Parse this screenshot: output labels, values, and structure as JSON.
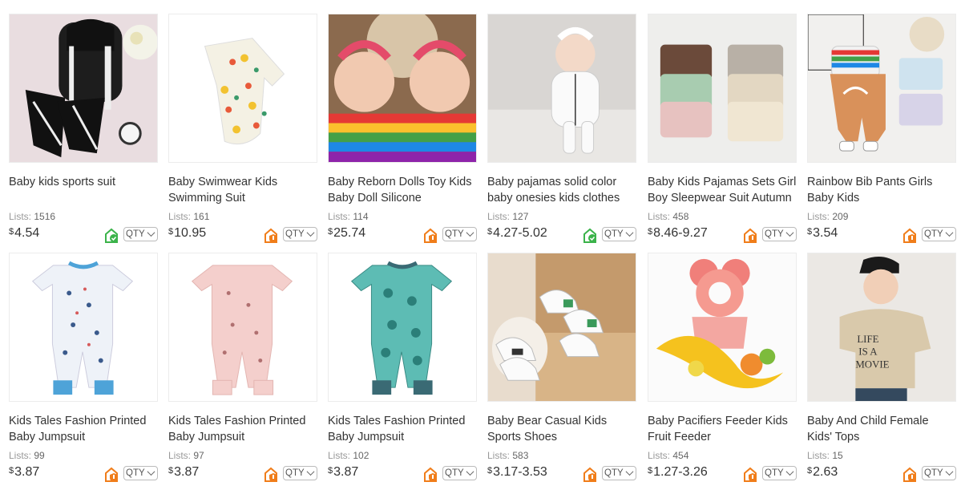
{
  "products": [
    {
      "title": "Baby kids sports suit",
      "lists_label": "Lists:",
      "lists": "1516",
      "currency": "$",
      "price": "4.54",
      "badge": "green-shield-icon",
      "qty_label": "QTY"
    },
    {
      "title": "Baby Swimwear Kids Swimming Suit",
      "lists_label": "Lists:",
      "lists": "161",
      "currency": "$",
      "price": "10.95",
      "badge": "orange-shield-icon",
      "qty_label": "QTY"
    },
    {
      "title": "Baby Reborn Dolls Toy Kids Baby Doll Silicone",
      "lists_label": "Lists:",
      "lists": "114",
      "currency": "$",
      "price": "25.74",
      "badge": "orange-shield-icon",
      "qty_label": "QTY"
    },
    {
      "title": "Baby pajamas solid color baby onesies kids clothes",
      "lists_label": "Lists:",
      "lists": "127",
      "currency": "$",
      "price": "4.27-5.02",
      "badge": "green-shield-icon",
      "qty_label": "QTY"
    },
    {
      "title": "Baby Kids Pajamas Sets Girl Boy Sleepwear Suit Autumn",
      "lists_label": "Lists:",
      "lists": "458",
      "currency": "$",
      "price": "8.46-9.27",
      "badge": "orange-shield-icon",
      "qty_label": "QTY"
    },
    {
      "title": "Rainbow Bib Pants Girls Baby Kids",
      "lists_label": "Lists:",
      "lists": "209",
      "currency": "$",
      "price": "3.54",
      "badge": "orange-shield-icon",
      "qty_label": "QTY"
    },
    {
      "title": "Kids Tales Fashion Printed Baby Jumpsuit",
      "lists_label": "Lists:",
      "lists": "99",
      "currency": "$",
      "price": "3.87",
      "badge": "orange-shield-icon",
      "qty_label": "QTY"
    },
    {
      "title": "Kids Tales Fashion Printed Baby Jumpsuit",
      "lists_label": "Lists:",
      "lists": "97",
      "currency": "$",
      "price": "3.87",
      "badge": "orange-shield-icon",
      "qty_label": "QTY"
    },
    {
      "title": "Kids Tales Fashion Printed Baby Jumpsuit",
      "lists_label": "Lists:",
      "lists": "102",
      "currency": "$",
      "price": "3.87",
      "badge": "orange-shield-icon",
      "qty_label": "QTY"
    },
    {
      "title": "Baby Bear Casual Kids Sports Shoes",
      "lists_label": "Lists:",
      "lists": "583",
      "currency": "$",
      "price": "3.17-3.53",
      "badge": "orange-shield-icon",
      "qty_label": "QTY"
    },
    {
      "title": "Baby Pacifiers Feeder Kids Fruit Feeder",
      "lists_label": "Lists:",
      "lists": "454",
      "currency": "$",
      "price": "1.27-3.26",
      "badge": "orange-shield-icon",
      "qty_label": "QTY"
    },
    {
      "title": "Baby And Child Female Kids' Tops",
      "lists_label": "Lists:",
      "lists": "15",
      "currency": "$",
      "price": "2.63",
      "badge": "orange-shield-icon",
      "qty_label": "QTY"
    }
  ],
  "colors": {
    "green_badge": "#3bb34a",
    "orange_badge": "#f07d1a"
  }
}
